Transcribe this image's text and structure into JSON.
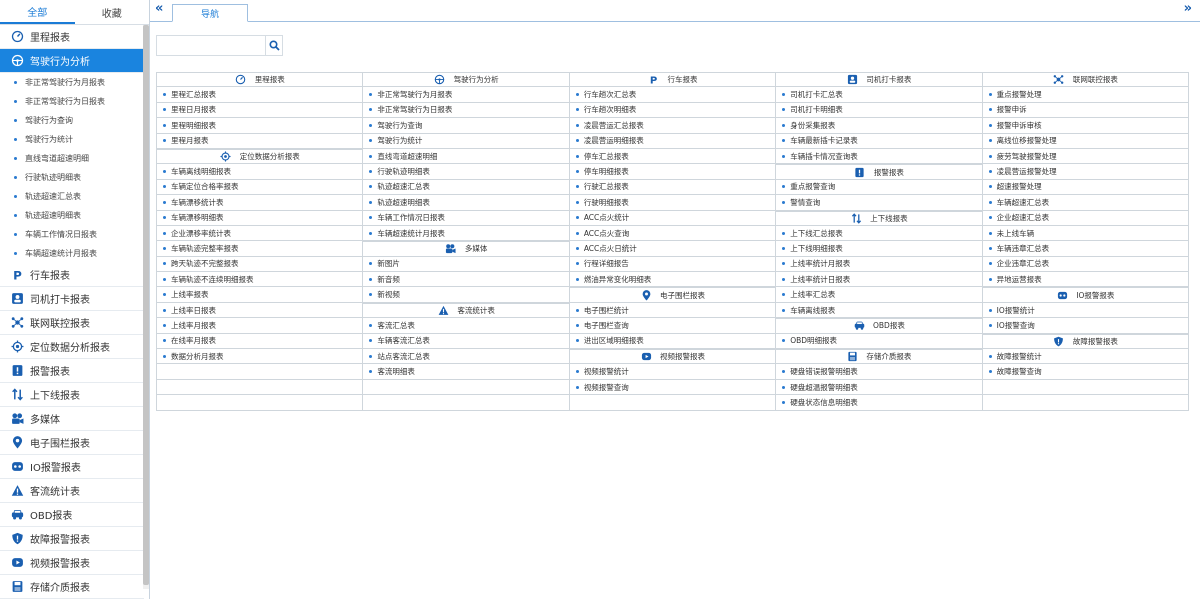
{
  "sidebar": {
    "tabs": [
      "全部",
      "收藏"
    ],
    "groups": [
      {
        "label": "里程报表",
        "icon": "gauge-icon"
      },
      {
        "label": "驾驶行为分析",
        "icon": "steering-wheel-icon",
        "active": true,
        "children": [
          "非正常驾驶行为月报表",
          "非正常驾驶行为日报表",
          "驾驶行为查询",
          "驾驶行为统计",
          "直线弯道超速明细",
          "行驶轨迹明细表",
          "轨迹超速汇总表",
          "轨迹超速明细表",
          "车辆工作情况日报表",
          "车辆超速统计月报表"
        ]
      },
      {
        "label": "行车报表",
        "icon": "parking-icon"
      },
      {
        "label": "司机打卡报表",
        "icon": "driver-card-icon"
      },
      {
        "label": "联网联控报表",
        "icon": "network-icon"
      },
      {
        "label": "定位数据分析报表",
        "icon": "target-icon"
      },
      {
        "label": "报警报表",
        "icon": "alarm-icon"
      },
      {
        "label": "上下线报表",
        "icon": "up-down-icon"
      },
      {
        "label": "多媒体",
        "icon": "multimedia-icon"
      },
      {
        "label": "电子围栏报表",
        "icon": "location-pin-icon"
      },
      {
        "label": "IO报警报表",
        "icon": "io-icon"
      },
      {
        "label": "客流统计表",
        "icon": "warning-icon"
      },
      {
        "label": "OBD报表",
        "icon": "car-icon"
      },
      {
        "label": "故障报警报表",
        "icon": "shield-icon"
      },
      {
        "label": "视频报警报表",
        "icon": "video-icon"
      },
      {
        "label": "存储介质报表",
        "icon": "storage-icon"
      }
    ]
  },
  "topbar": {
    "collapse_left": "«",
    "collapse_right": "»",
    "tab_label": "导航"
  },
  "search": {
    "placeholder": "",
    "value": ""
  },
  "grid": {
    "columns": [
      [
        {
          "type": "head",
          "label": "里程报表",
          "icon": "gauge-icon"
        },
        {
          "label": "里程汇总报表"
        },
        {
          "label": "里程日月报表"
        },
        {
          "label": "里程明细报表"
        },
        {
          "label": "里程月报表"
        },
        {
          "type": "head",
          "label": "定位数据分析报表",
          "icon": "target-icon"
        },
        {
          "label": "车辆离线明细报表"
        },
        {
          "label": "车辆定位合格率报表"
        },
        {
          "label": "车辆漂移统计表"
        },
        {
          "label": "车辆漂移明细表"
        },
        {
          "label": "企业漂移率统计表"
        },
        {
          "label": "车辆轨迹完整率报表"
        },
        {
          "label": "跨天轨迹不完整报表"
        },
        {
          "label": "车辆轨迹不连续明细报表"
        },
        {
          "label": "上线率报表"
        },
        {
          "label": "上线率日报表"
        },
        {
          "label": "上线率月报表"
        },
        {
          "label": "在线率月报表"
        },
        {
          "label": "数据分析月报表"
        },
        {
          "type": "blank"
        },
        {
          "type": "blank"
        },
        {
          "type": "blank"
        }
      ],
      [
        {
          "type": "head",
          "label": "驾驶行为分析",
          "icon": "steering-wheel-icon"
        },
        {
          "label": "非正常驾驶行为月报表"
        },
        {
          "label": "非正常驾驶行为日报表"
        },
        {
          "label": "驾驶行为查询"
        },
        {
          "label": "驾驶行为统计"
        },
        {
          "label": "直线弯道超速明细"
        },
        {
          "label": "行驶轨迹明细表"
        },
        {
          "label": "轨迹超速汇总表"
        },
        {
          "label": "轨迹超速明细表"
        },
        {
          "label": "车辆工作情况日报表"
        },
        {
          "label": "车辆超速统计月报表"
        },
        {
          "type": "head",
          "label": "多媒体",
          "icon": "multimedia-icon"
        },
        {
          "label": "新图片"
        },
        {
          "label": "新音频"
        },
        {
          "label": "新视频"
        },
        {
          "type": "head",
          "label": "客流统计表",
          "icon": "warning-icon"
        },
        {
          "label": "客流汇总表"
        },
        {
          "label": "车辆客流汇总表"
        },
        {
          "label": "站点客流汇总表"
        },
        {
          "label": "客流明细表"
        },
        {
          "type": "blank"
        },
        {
          "type": "blank"
        }
      ],
      [
        {
          "type": "head",
          "label": "行车报表",
          "icon": "parking-icon"
        },
        {
          "label": "行车趟次汇总表"
        },
        {
          "label": "行车趟次明细表"
        },
        {
          "label": "凌晨营运汇总报表"
        },
        {
          "label": "凌晨营运明细报表"
        },
        {
          "label": "停车汇总报表"
        },
        {
          "label": "停车明细报表"
        },
        {
          "label": "行驶汇总报表"
        },
        {
          "label": "行驶明细报表"
        },
        {
          "label": "ACC点火统计"
        },
        {
          "label": "ACC点火查询"
        },
        {
          "label": "ACC点火日统计"
        },
        {
          "label": "行程详细报告"
        },
        {
          "label": "燃油异常变化明细表"
        },
        {
          "type": "head",
          "label": "电子围栏报表",
          "icon": "location-pin-icon"
        },
        {
          "label": "电子围栏统计"
        },
        {
          "label": "电子围栏查询"
        },
        {
          "label": "进出区域明细报表"
        },
        {
          "type": "head",
          "label": "视频报警报表",
          "icon": "video-icon"
        },
        {
          "label": "视频报警统计"
        },
        {
          "label": "视频报警查询"
        },
        {
          "type": "blank"
        }
      ],
      [
        {
          "type": "head",
          "label": "司机打卡报表",
          "icon": "driver-card-icon"
        },
        {
          "label": "司机打卡汇总表"
        },
        {
          "label": "司机打卡明细表"
        },
        {
          "label": "身份采集报表"
        },
        {
          "label": "车辆最新插卡记录表"
        },
        {
          "label": "车辆插卡情况查询表"
        },
        {
          "type": "head",
          "label": "报警报表",
          "icon": "alarm-icon"
        },
        {
          "label": "重点报警查询"
        },
        {
          "label": "警情查询"
        },
        {
          "type": "head",
          "label": "上下线报表",
          "icon": "up-down-icon"
        },
        {
          "label": "上下线汇总报表"
        },
        {
          "label": "上下线明细报表"
        },
        {
          "label": "上线率统计月报表"
        },
        {
          "label": "上线率统计日报表"
        },
        {
          "label": "上线率汇总表"
        },
        {
          "label": "车辆离线报表"
        },
        {
          "type": "head",
          "label": "OBD报表",
          "icon": "car-icon"
        },
        {
          "label": "OBD明细报表"
        },
        {
          "type": "head",
          "label": "存储介质报表",
          "icon": "storage-icon"
        },
        {
          "label": "硬盘错误报警明细表"
        },
        {
          "label": "硬盘超温报警明细表"
        },
        {
          "label": "硬盘状态信息明细表"
        }
      ],
      [
        {
          "type": "head",
          "label": "联网联控报表",
          "icon": "network-icon"
        },
        {
          "label": "重点报警处理"
        },
        {
          "label": "报警申诉"
        },
        {
          "label": "报警申诉审核"
        },
        {
          "label": "离线位移报警处理"
        },
        {
          "label": "疲劳驾驶报警处理"
        },
        {
          "label": "凌晨营运报警处理"
        },
        {
          "label": "超速报警处理"
        },
        {
          "label": "车辆超速汇总表"
        },
        {
          "label": "企业超速汇总表"
        },
        {
          "label": "未上线车辆"
        },
        {
          "label": "车辆违章汇总表"
        },
        {
          "label": "企业违章汇总表"
        },
        {
          "label": "异地运营报表"
        },
        {
          "type": "head",
          "label": "IO报警报表",
          "icon": "io-icon"
        },
        {
          "label": "IO报警统计"
        },
        {
          "label": "IO报警查询"
        },
        {
          "type": "head",
          "label": "故障报警报表",
          "icon": "shield-icon"
        },
        {
          "label": "故障报警统计"
        },
        {
          "label": "故障报警查询"
        },
        {
          "type": "blank"
        },
        {
          "type": "blank"
        }
      ]
    ]
  }
}
